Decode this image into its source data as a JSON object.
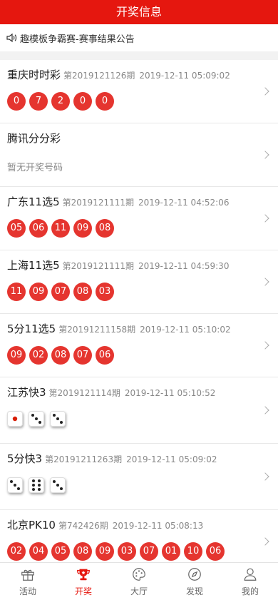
{
  "header": {
    "title": "开奖信息"
  },
  "notice": {
    "text": "趣模板争霸赛-赛事结果公告"
  },
  "lotteries": [
    {
      "name": "重庆时时彩",
      "issue": "第2019121126期",
      "time": "2019-12-11 05:09:02",
      "numbers": [
        "0",
        "7",
        "2",
        "0",
        "0"
      ]
    },
    {
      "name": "腾讯分分彩",
      "no_draw": "暂无开奖号码"
    },
    {
      "name": "广东11选5",
      "issue": "第2019121111期",
      "time": "2019-12-11 04:52:06",
      "numbers": [
        "05",
        "06",
        "11",
        "09",
        "08"
      ]
    },
    {
      "name": "上海11选5",
      "issue": "第2019121111期",
      "time": "2019-12-11 04:59:30",
      "numbers": [
        "11",
        "09",
        "07",
        "08",
        "03"
      ]
    },
    {
      "name": "5分11选5",
      "issue": "第20191211158期",
      "time": "2019-12-11 05:10:02",
      "numbers": [
        "09",
        "02",
        "08",
        "07",
        "06"
      ]
    },
    {
      "name": "江苏快3",
      "issue": "第2019121114期",
      "time": "2019-12-11 05:10:52",
      "dice": [
        1,
        3,
        3
      ]
    },
    {
      "name": "5分快3",
      "issue": "第20191211263期",
      "time": "2019-12-11 05:09:02",
      "dice": [
        3,
        6,
        3
      ]
    },
    {
      "name": "北京PK10",
      "issue": "第742426期",
      "time": "2019-12-11 05:08:13",
      "numbers": [
        "02",
        "04",
        "05",
        "08",
        "09",
        "03",
        "07",
        "01",
        "10",
        "06"
      ]
    }
  ],
  "tabs": [
    {
      "label": "活动",
      "icon": "gift-icon"
    },
    {
      "label": "开奖",
      "icon": "trophy-icon"
    },
    {
      "label": "大厅",
      "icon": "palette-icon"
    },
    {
      "label": "发现",
      "icon": "compass-icon"
    },
    {
      "label": "我的",
      "icon": "user-icon"
    }
  ],
  "colors": {
    "brand": "#e5170f",
    "ball": "#e5352f"
  }
}
